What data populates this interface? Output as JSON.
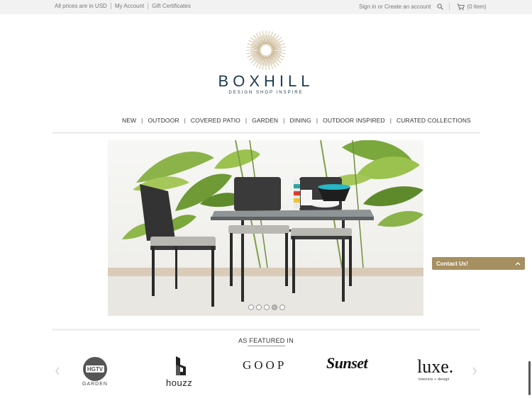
{
  "topbar": {
    "currency": "All prices are in USD",
    "my_account": "My Account",
    "gift_certificates": "Gift Certificates",
    "sign_in": "Sign in or Create an account",
    "cart_label": "(0 item)"
  },
  "brand": {
    "name": "BOXHILL",
    "tagline": "DESIGN   SHOP   INSPIRE"
  },
  "nav": {
    "items": [
      "NEW",
      "OUTDOOR",
      "COVERED PATIO",
      "GARDEN",
      "DINING",
      "OUTDOOR INSPIRED",
      "CURATED COLLECTIONS"
    ]
  },
  "hero": {
    "slide_count": 5,
    "active_slide": 4
  },
  "contact": {
    "label": "Contact Us!"
  },
  "featured": {
    "title": "AS FEATURED IN",
    "logos": {
      "hgtv_badge": "HGTV",
      "hgtv_sub": "GARDEN",
      "houzz": "houzz",
      "goop": "GOOP",
      "sunset": "Sunset",
      "luxe": "luxe.",
      "luxe_sub": "interiors + design"
    }
  },
  "colors": {
    "brand_navy": "#1f3b4d",
    "accent_gold": "#a68f60",
    "topbar_bg": "#f2f2f2"
  }
}
